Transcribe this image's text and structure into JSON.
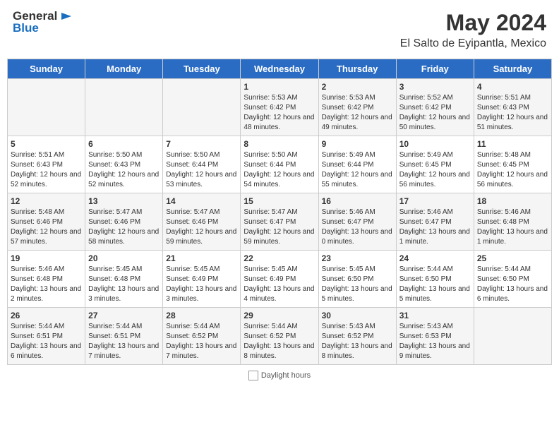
{
  "header": {
    "logo_general": "General",
    "logo_blue": "Blue",
    "main_title": "May 2024",
    "subtitle": "El Salto de Eyipantla, Mexico"
  },
  "days_of_week": [
    "Sunday",
    "Monday",
    "Tuesday",
    "Wednesday",
    "Thursday",
    "Friday",
    "Saturday"
  ],
  "weeks": [
    [
      {
        "day": "",
        "info": ""
      },
      {
        "day": "",
        "info": ""
      },
      {
        "day": "",
        "info": ""
      },
      {
        "day": "1",
        "info": "Sunrise: 5:53 AM\nSunset: 6:42 PM\nDaylight: 12 hours and 48 minutes."
      },
      {
        "day": "2",
        "info": "Sunrise: 5:53 AM\nSunset: 6:42 PM\nDaylight: 12 hours and 49 minutes."
      },
      {
        "day": "3",
        "info": "Sunrise: 5:52 AM\nSunset: 6:42 PM\nDaylight: 12 hours and 50 minutes."
      },
      {
        "day": "4",
        "info": "Sunrise: 5:51 AM\nSunset: 6:43 PM\nDaylight: 12 hours and 51 minutes."
      }
    ],
    [
      {
        "day": "5",
        "info": "Sunrise: 5:51 AM\nSunset: 6:43 PM\nDaylight: 12 hours and 52 minutes."
      },
      {
        "day": "6",
        "info": "Sunrise: 5:50 AM\nSunset: 6:43 PM\nDaylight: 12 hours and 52 minutes."
      },
      {
        "day": "7",
        "info": "Sunrise: 5:50 AM\nSunset: 6:44 PM\nDaylight: 12 hours and 53 minutes."
      },
      {
        "day": "8",
        "info": "Sunrise: 5:50 AM\nSunset: 6:44 PM\nDaylight: 12 hours and 54 minutes."
      },
      {
        "day": "9",
        "info": "Sunrise: 5:49 AM\nSunset: 6:44 PM\nDaylight: 12 hours and 55 minutes."
      },
      {
        "day": "10",
        "info": "Sunrise: 5:49 AM\nSunset: 6:45 PM\nDaylight: 12 hours and 56 minutes."
      },
      {
        "day": "11",
        "info": "Sunrise: 5:48 AM\nSunset: 6:45 PM\nDaylight: 12 hours and 56 minutes."
      }
    ],
    [
      {
        "day": "12",
        "info": "Sunrise: 5:48 AM\nSunset: 6:46 PM\nDaylight: 12 hours and 57 minutes."
      },
      {
        "day": "13",
        "info": "Sunrise: 5:47 AM\nSunset: 6:46 PM\nDaylight: 12 hours and 58 minutes."
      },
      {
        "day": "14",
        "info": "Sunrise: 5:47 AM\nSunset: 6:46 PM\nDaylight: 12 hours and 59 minutes."
      },
      {
        "day": "15",
        "info": "Sunrise: 5:47 AM\nSunset: 6:47 PM\nDaylight: 12 hours and 59 minutes."
      },
      {
        "day": "16",
        "info": "Sunrise: 5:46 AM\nSunset: 6:47 PM\nDaylight: 13 hours and 0 minutes."
      },
      {
        "day": "17",
        "info": "Sunrise: 5:46 AM\nSunset: 6:47 PM\nDaylight: 13 hours and 1 minute."
      },
      {
        "day": "18",
        "info": "Sunrise: 5:46 AM\nSunset: 6:48 PM\nDaylight: 13 hours and 1 minute."
      }
    ],
    [
      {
        "day": "19",
        "info": "Sunrise: 5:46 AM\nSunset: 6:48 PM\nDaylight: 13 hours and 2 minutes."
      },
      {
        "day": "20",
        "info": "Sunrise: 5:45 AM\nSunset: 6:48 PM\nDaylight: 13 hours and 3 minutes."
      },
      {
        "day": "21",
        "info": "Sunrise: 5:45 AM\nSunset: 6:49 PM\nDaylight: 13 hours and 3 minutes."
      },
      {
        "day": "22",
        "info": "Sunrise: 5:45 AM\nSunset: 6:49 PM\nDaylight: 13 hours and 4 minutes."
      },
      {
        "day": "23",
        "info": "Sunrise: 5:45 AM\nSunset: 6:50 PM\nDaylight: 13 hours and 5 minutes."
      },
      {
        "day": "24",
        "info": "Sunrise: 5:44 AM\nSunset: 6:50 PM\nDaylight: 13 hours and 5 minutes."
      },
      {
        "day": "25",
        "info": "Sunrise: 5:44 AM\nSunset: 6:50 PM\nDaylight: 13 hours and 6 minutes."
      }
    ],
    [
      {
        "day": "26",
        "info": "Sunrise: 5:44 AM\nSunset: 6:51 PM\nDaylight: 13 hours and 6 minutes."
      },
      {
        "day": "27",
        "info": "Sunrise: 5:44 AM\nSunset: 6:51 PM\nDaylight: 13 hours and 7 minutes."
      },
      {
        "day": "28",
        "info": "Sunrise: 5:44 AM\nSunset: 6:52 PM\nDaylight: 13 hours and 7 minutes."
      },
      {
        "day": "29",
        "info": "Sunrise: 5:44 AM\nSunset: 6:52 PM\nDaylight: 13 hours and 8 minutes."
      },
      {
        "day": "30",
        "info": "Sunrise: 5:43 AM\nSunset: 6:52 PM\nDaylight: 13 hours and 8 minutes."
      },
      {
        "day": "31",
        "info": "Sunrise: 5:43 AM\nSunset: 6:53 PM\nDaylight: 13 hours and 9 minutes."
      },
      {
        "day": "",
        "info": ""
      }
    ]
  ],
  "footer": {
    "daylight_label": "Daylight hours"
  }
}
